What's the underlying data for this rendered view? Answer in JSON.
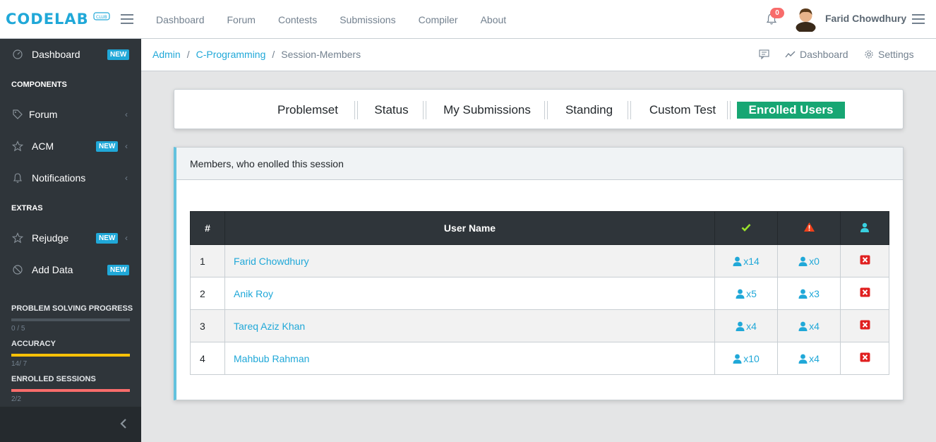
{
  "header": {
    "logo_text": "CODELAB",
    "logo_sub": "CLUB",
    "nav": [
      "Dashboard",
      "Forum",
      "Contests",
      "Submissions",
      "Compiler",
      "About"
    ],
    "notification_count": "0",
    "user_name": "Farid Chowdhury"
  },
  "sidebar": {
    "items": [
      {
        "label": "Dashboard",
        "badge": "NEW",
        "icon": "speedometer-icon"
      },
      {
        "label": "Forum",
        "icon": "tag-icon"
      },
      {
        "label": "ACM",
        "badge": "NEW",
        "icon": "star-icon"
      },
      {
        "label": "Notifications",
        "icon": "bell-icon"
      },
      {
        "label": "Rejudge",
        "badge": "NEW",
        "icon": "star-icon"
      },
      {
        "label": "Add Data",
        "badge": "NEW",
        "icon": "ban-icon"
      }
    ],
    "section_components": "COMPONENTS",
    "section_extras": "EXTRAS",
    "progress": [
      {
        "title": "PROBLEM SOLVING PROGRESS",
        "value": "0 / 5",
        "fraction": 0,
        "color": "#73818f"
      },
      {
        "title": "ACCURACY",
        "value": "14/ 7",
        "fraction": 1,
        "color": "#ffc107"
      },
      {
        "title": "ENROLLED SESSIONS",
        "value": "2/2",
        "fraction": 1,
        "color": "#f86c6b"
      }
    ]
  },
  "breadcrumb": {
    "items": [
      "Admin",
      "C-Programming",
      "Session-Members"
    ],
    "separator": "/",
    "actions": {
      "dashboard": "Dashboard",
      "settings": "Settings"
    }
  },
  "tabs": [
    "Problemset",
    "Status",
    "My Submissions",
    "Standing",
    "Custom Test",
    "Enrolled Users"
  ],
  "members": {
    "header": "Members, who enolled this session",
    "columns": {
      "num": "#",
      "username": "User Name"
    },
    "rows": [
      {
        "num": "1",
        "name": "Farid Chowdhury",
        "accepted": "x14",
        "wrong": "x0"
      },
      {
        "num": "2",
        "name": "Anik Roy",
        "accepted": "x5",
        "wrong": "x3"
      },
      {
        "num": "3",
        "name": "Tareq Aziz Khan",
        "accepted": "x4",
        "wrong": "x4"
      },
      {
        "num": "4",
        "name": "Mahbub Rahman",
        "accepted": "x10",
        "wrong": "x4"
      }
    ]
  },
  "colors": {
    "accent": "#20a8d8",
    "tab_active": "#17a673",
    "sidebar": "#2f353a",
    "danger": "#e02020",
    "success": "#4dbd74",
    "warning": "#f86c6b",
    "info": "#39d0e0"
  }
}
